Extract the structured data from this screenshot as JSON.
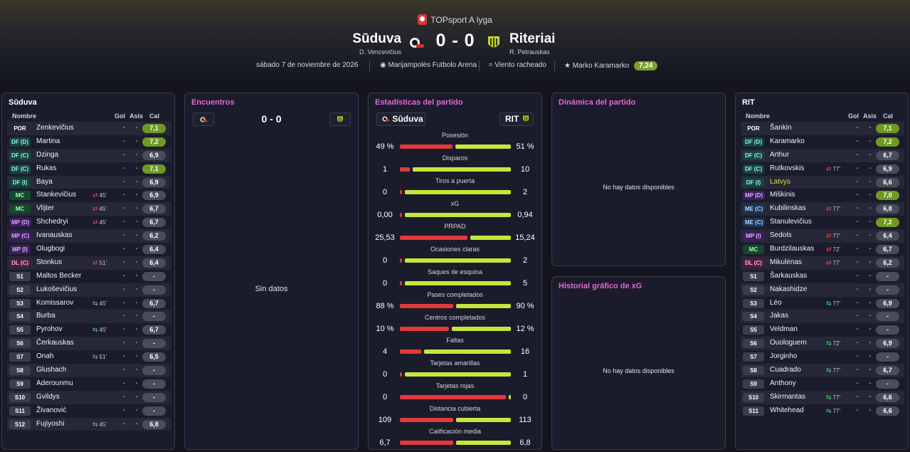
{
  "league": "TOPsport A lyga",
  "home": {
    "name": "Sūduva",
    "coach": "D. Vencevičius",
    "short": "Sūduva"
  },
  "away": {
    "name": "Riteriai",
    "coach": "R. Petrauskas",
    "short": "RIT"
  },
  "score": "0 - 0",
  "meta": {
    "date": "sábado 7 de noviembre de 2026",
    "stadium": "Marijampolės Futbolo Arena",
    "weather": "Viento racheado",
    "mvp": "Marko Karamarko",
    "mvp_rating": "7,24"
  },
  "colors": {
    "accent_title": "#e267d9",
    "home_bar": "#e03a3a",
    "away_bar": "#c8e63a",
    "good_rating": "#6e9a22"
  },
  "panels": {
    "home_title": "Sūduva",
    "away_title": "RIT",
    "encuentros_title": "Encuentros",
    "stats_title": "Estadísticas del partido",
    "dynamics_title": "Dinámica del partido",
    "xg_title": "Historial gráfico de xG",
    "no_data": "No hay datos disponibles",
    "sin_datos": "Sin datos",
    "enc_score": "0 - 0"
  },
  "lineup_headers": {
    "name": "Nombre",
    "goals": "Gol",
    "assists": "Asis",
    "rating": "Cal"
  },
  "home_players": [
    {
      "pos": "POR",
      "type": "gk",
      "name": "Zenkevičius",
      "sub": "",
      "dir": "",
      "g": "-",
      "a": "-",
      "rating": "7,1",
      "good": true
    },
    {
      "pos": "DF (D)",
      "type": "df",
      "name": "Martina",
      "sub": "",
      "dir": "",
      "g": "-",
      "a": "-",
      "rating": "7,2",
      "good": true
    },
    {
      "pos": "DF (C)",
      "type": "df",
      "name": "Dzinga",
      "sub": "",
      "dir": "",
      "g": "-",
      "a": "-",
      "rating": "6,9",
      "good": false
    },
    {
      "pos": "DF (C)",
      "type": "df",
      "name": "Rukas",
      "sub": "",
      "dir": "",
      "g": "-",
      "a": "-",
      "rating": "7,1",
      "good": true
    },
    {
      "pos": "DF (I)",
      "type": "df",
      "name": "Baya",
      "sub": "",
      "dir": "",
      "g": "-",
      "a": "-",
      "rating": "6,9",
      "good": false
    },
    {
      "pos": "MC",
      "type": "mc",
      "name": "Stankevičius",
      "sub": "45'",
      "dir": "out",
      "g": "-",
      "a": "-",
      "rating": "6,9",
      "good": false
    },
    {
      "pos": "MC",
      "type": "mc",
      "name": "Vlijter",
      "sub": "45'",
      "dir": "out",
      "g": "-",
      "a": "-",
      "rating": "6,7",
      "good": false
    },
    {
      "pos": "MP (D)",
      "type": "mp",
      "name": "Shchedryi",
      "sub": "45'",
      "dir": "out",
      "g": "-",
      "a": "-",
      "rating": "6,7",
      "good": false
    },
    {
      "pos": "MP (C)",
      "type": "mp",
      "name": "Ivanauskas",
      "sub": "",
      "dir": "",
      "g": "-",
      "a": "-",
      "rating": "6,2",
      "good": false
    },
    {
      "pos": "MP (I)",
      "type": "mp",
      "name": "Olugbogi",
      "sub": "",
      "dir": "",
      "g": "-",
      "a": "-",
      "rating": "6,4",
      "good": false
    },
    {
      "pos": "DL (C)",
      "type": "dl",
      "name": "Stonkus",
      "sub": "51'",
      "dir": "out",
      "g": "-",
      "a": "-",
      "rating": "6,4",
      "good": false
    },
    {
      "pos": "S1",
      "type": "sub",
      "name": "Maltos Becker",
      "sub": "",
      "dir": "",
      "g": "-",
      "a": "-",
      "rating": "-",
      "good": false
    },
    {
      "pos": "S2",
      "type": "sub",
      "name": "Lukoševičius",
      "sub": "",
      "dir": "",
      "g": "-",
      "a": "-",
      "rating": "-",
      "good": false
    },
    {
      "pos": "S3",
      "type": "sub",
      "name": "Komissarov",
      "sub": "45'",
      "dir": "in",
      "g": "-",
      "a": "-",
      "rating": "6,7",
      "good": false
    },
    {
      "pos": "S4",
      "type": "sub",
      "name": "Burba",
      "sub": "",
      "dir": "",
      "g": "-",
      "a": "-",
      "rating": "-",
      "good": false
    },
    {
      "pos": "S5",
      "type": "sub",
      "name": "Pyrohov",
      "sub": "45'",
      "dir": "in",
      "g": "-",
      "a": "-",
      "rating": "6,7",
      "good": false
    },
    {
      "pos": "S6",
      "type": "sub",
      "name": "Čerkauskas",
      "sub": "",
      "dir": "",
      "g": "-",
      "a": "-",
      "rating": "-",
      "good": false
    },
    {
      "pos": "S7",
      "type": "sub",
      "name": "Onah",
      "sub": "51'",
      "dir": "in",
      "g": "-",
      "a": "-",
      "rating": "6,5",
      "good": false
    },
    {
      "pos": "S8",
      "type": "sub",
      "name": "Glushach",
      "sub": "",
      "dir": "",
      "g": "-",
      "a": "-",
      "rating": "-",
      "good": false
    },
    {
      "pos": "S9",
      "type": "sub",
      "name": "Aderounmu",
      "sub": "",
      "dir": "",
      "g": "-",
      "a": "-",
      "rating": "-",
      "good": false
    },
    {
      "pos": "S10",
      "type": "sub",
      "name": "Gvildys",
      "sub": "",
      "dir": "",
      "g": "-",
      "a": "-",
      "rating": "-",
      "good": false
    },
    {
      "pos": "S11",
      "type": "sub",
      "name": "Živanović",
      "sub": "",
      "dir": "",
      "g": "-",
      "a": "-",
      "rating": "-",
      "good": false
    },
    {
      "pos": "S12",
      "type": "sub",
      "name": "Fujiyoshi",
      "sub": "45'",
      "dir": "in",
      "g": "-",
      "a": "-",
      "rating": "6,8",
      "good": false
    }
  ],
  "away_players": [
    {
      "pos": "POR",
      "type": "gk",
      "name": "Šankin",
      "sub": "",
      "dir": "",
      "g": "-",
      "a": "-",
      "rating": "7,1",
      "good": true
    },
    {
      "pos": "DF (D)",
      "type": "df",
      "name": "Karamarko",
      "sub": "",
      "dir": "",
      "g": "-",
      "a": "-",
      "rating": "7,2",
      "good": true
    },
    {
      "pos": "DF (C)",
      "type": "df",
      "name": "Arthur",
      "sub": "",
      "dir": "",
      "g": "-",
      "a": "-",
      "rating": "6,7",
      "good": false
    },
    {
      "pos": "DF (C)",
      "type": "df",
      "name": "Rutkovskis",
      "sub": "77'",
      "dir": "out",
      "g": "-",
      "a": "-",
      "rating": "6,9",
      "good": false
    },
    {
      "pos": "DF (I)",
      "type": "df",
      "name": "Latvys",
      "sub": "",
      "dir": "",
      "g": "-",
      "a": "-",
      "rating": "6,6",
      "good": false,
      "highlight": true
    },
    {
      "pos": "MP (D)",
      "type": "mp",
      "name": "Miškinis",
      "sub": "",
      "dir": "",
      "g": "-",
      "a": "-",
      "rating": "7,0",
      "good": true
    },
    {
      "pos": "ME (C)",
      "type": "me",
      "name": "Kubilinskas",
      "sub": "77'",
      "dir": "out",
      "g": "-",
      "a": "-",
      "rating": "6,8",
      "good": false
    },
    {
      "pos": "ME (C)",
      "type": "me",
      "name": "Stanulevičius",
      "sub": "",
      "dir": "",
      "g": "-",
      "a": "-",
      "rating": "7,2",
      "good": true
    },
    {
      "pos": "MP (I)",
      "type": "mp",
      "name": "Sedols",
      "sub": "77'",
      "dir": "out",
      "g": "-",
      "a": "-",
      "rating": "6,4",
      "good": false
    },
    {
      "pos": "MC",
      "type": "mc",
      "name": "Burdzilauskas",
      "sub": "72'",
      "dir": "out",
      "g": "-",
      "a": "-",
      "rating": "6,7",
      "good": false
    },
    {
      "pos": "DL (C)",
      "type": "dl",
      "name": "Mikulėnas",
      "sub": "77'",
      "dir": "out",
      "g": "-",
      "a": "-",
      "rating": "6,2",
      "good": false
    },
    {
      "pos": "S1",
      "type": "sub",
      "name": "Šarkauskas",
      "sub": "",
      "dir": "",
      "g": "-",
      "a": "-",
      "rating": "-",
      "good": false
    },
    {
      "pos": "S2",
      "type": "sub",
      "name": "Nakashidze",
      "sub": "",
      "dir": "",
      "g": "-",
      "a": "-",
      "rating": "-",
      "good": false
    },
    {
      "pos": "S3",
      "type": "sub",
      "name": "Léo",
      "sub": "77'",
      "dir": "in",
      "g": "-",
      "a": "-",
      "rating": "6,9",
      "good": false
    },
    {
      "pos": "S4",
      "type": "sub",
      "name": "Jakas",
      "sub": "",
      "dir": "",
      "g": "-",
      "a": "-",
      "rating": "-",
      "good": false
    },
    {
      "pos": "S5",
      "type": "sub",
      "name": "Veldman",
      "sub": "",
      "dir": "",
      "g": "-",
      "a": "-",
      "rating": "-",
      "good": false
    },
    {
      "pos": "S6",
      "type": "sub",
      "name": "Ouologuem",
      "sub": "72'",
      "dir": "in",
      "g": "-",
      "a": "-",
      "rating": "6,9",
      "good": false
    },
    {
      "pos": "S7",
      "type": "sub",
      "name": "Jorginho",
      "sub": "",
      "dir": "",
      "g": "-",
      "a": "-",
      "rating": "-",
      "good": false
    },
    {
      "pos": "S8",
      "type": "sub",
      "name": "Cuadrado",
      "sub": "77'",
      "dir": "in",
      "g": "-",
      "a": "-",
      "rating": "6,7",
      "good": false
    },
    {
      "pos": "S9",
      "type": "sub",
      "name": "Anthony",
      "sub": "",
      "dir": "",
      "g": "-",
      "a": "-",
      "rating": "-",
      "good": false
    },
    {
      "pos": "S10",
      "type": "sub",
      "name": "Skirmantas",
      "sub": "77'",
      "dir": "in",
      "g": "-",
      "a": "-",
      "rating": "6,6",
      "good": false
    },
    {
      "pos": "S11",
      "type": "sub",
      "name": "Whitehead",
      "sub": "77'",
      "dir": "in",
      "g": "-",
      "a": "-",
      "rating": "6,6",
      "good": false
    }
  ],
  "stats": [
    {
      "label": "Posesión",
      "home": "49 %",
      "away": "51 %",
      "home_share": 0.49
    },
    {
      "label": "Disparos",
      "home": "1",
      "away": "10",
      "home_share": 0.09
    },
    {
      "label": "Tiros a puerta",
      "home": "0",
      "away": "2",
      "home_share": 0.0
    },
    {
      "label": "xG",
      "home": "0,00",
      "away": "0,94",
      "home_share": 0.0
    },
    {
      "label": "PRPAD",
      "home": "25,53",
      "away": "15,24",
      "home_share": 0.626
    },
    {
      "label": "Ocasiones claras",
      "home": "0",
      "away": "2",
      "home_share": 0.0
    },
    {
      "label": "Saques de esquina",
      "home": "0",
      "away": "5",
      "home_share": 0.0
    },
    {
      "label": "Pases completados",
      "home": "88 %",
      "away": "90 %",
      "home_share": 0.494
    },
    {
      "label": "Centros completados",
      "home": "10 %",
      "away": "12 %",
      "home_share": 0.455
    },
    {
      "label": "Faltas",
      "home": "4",
      "away": "16",
      "home_share": 0.2
    },
    {
      "label": "Tarjetas amarillas",
      "home": "0",
      "away": "1",
      "home_share": 0.0
    },
    {
      "label": "Tarjetas rojas",
      "home": "0",
      "away": "0",
      "home_share": 1.0
    },
    {
      "label": "Distancia cubierta",
      "home": "109",
      "away": "113",
      "home_share": 0.491
    },
    {
      "label": "Calificación media",
      "home": "6,7",
      "away": "6,8",
      "home_share": 0.496
    }
  ]
}
